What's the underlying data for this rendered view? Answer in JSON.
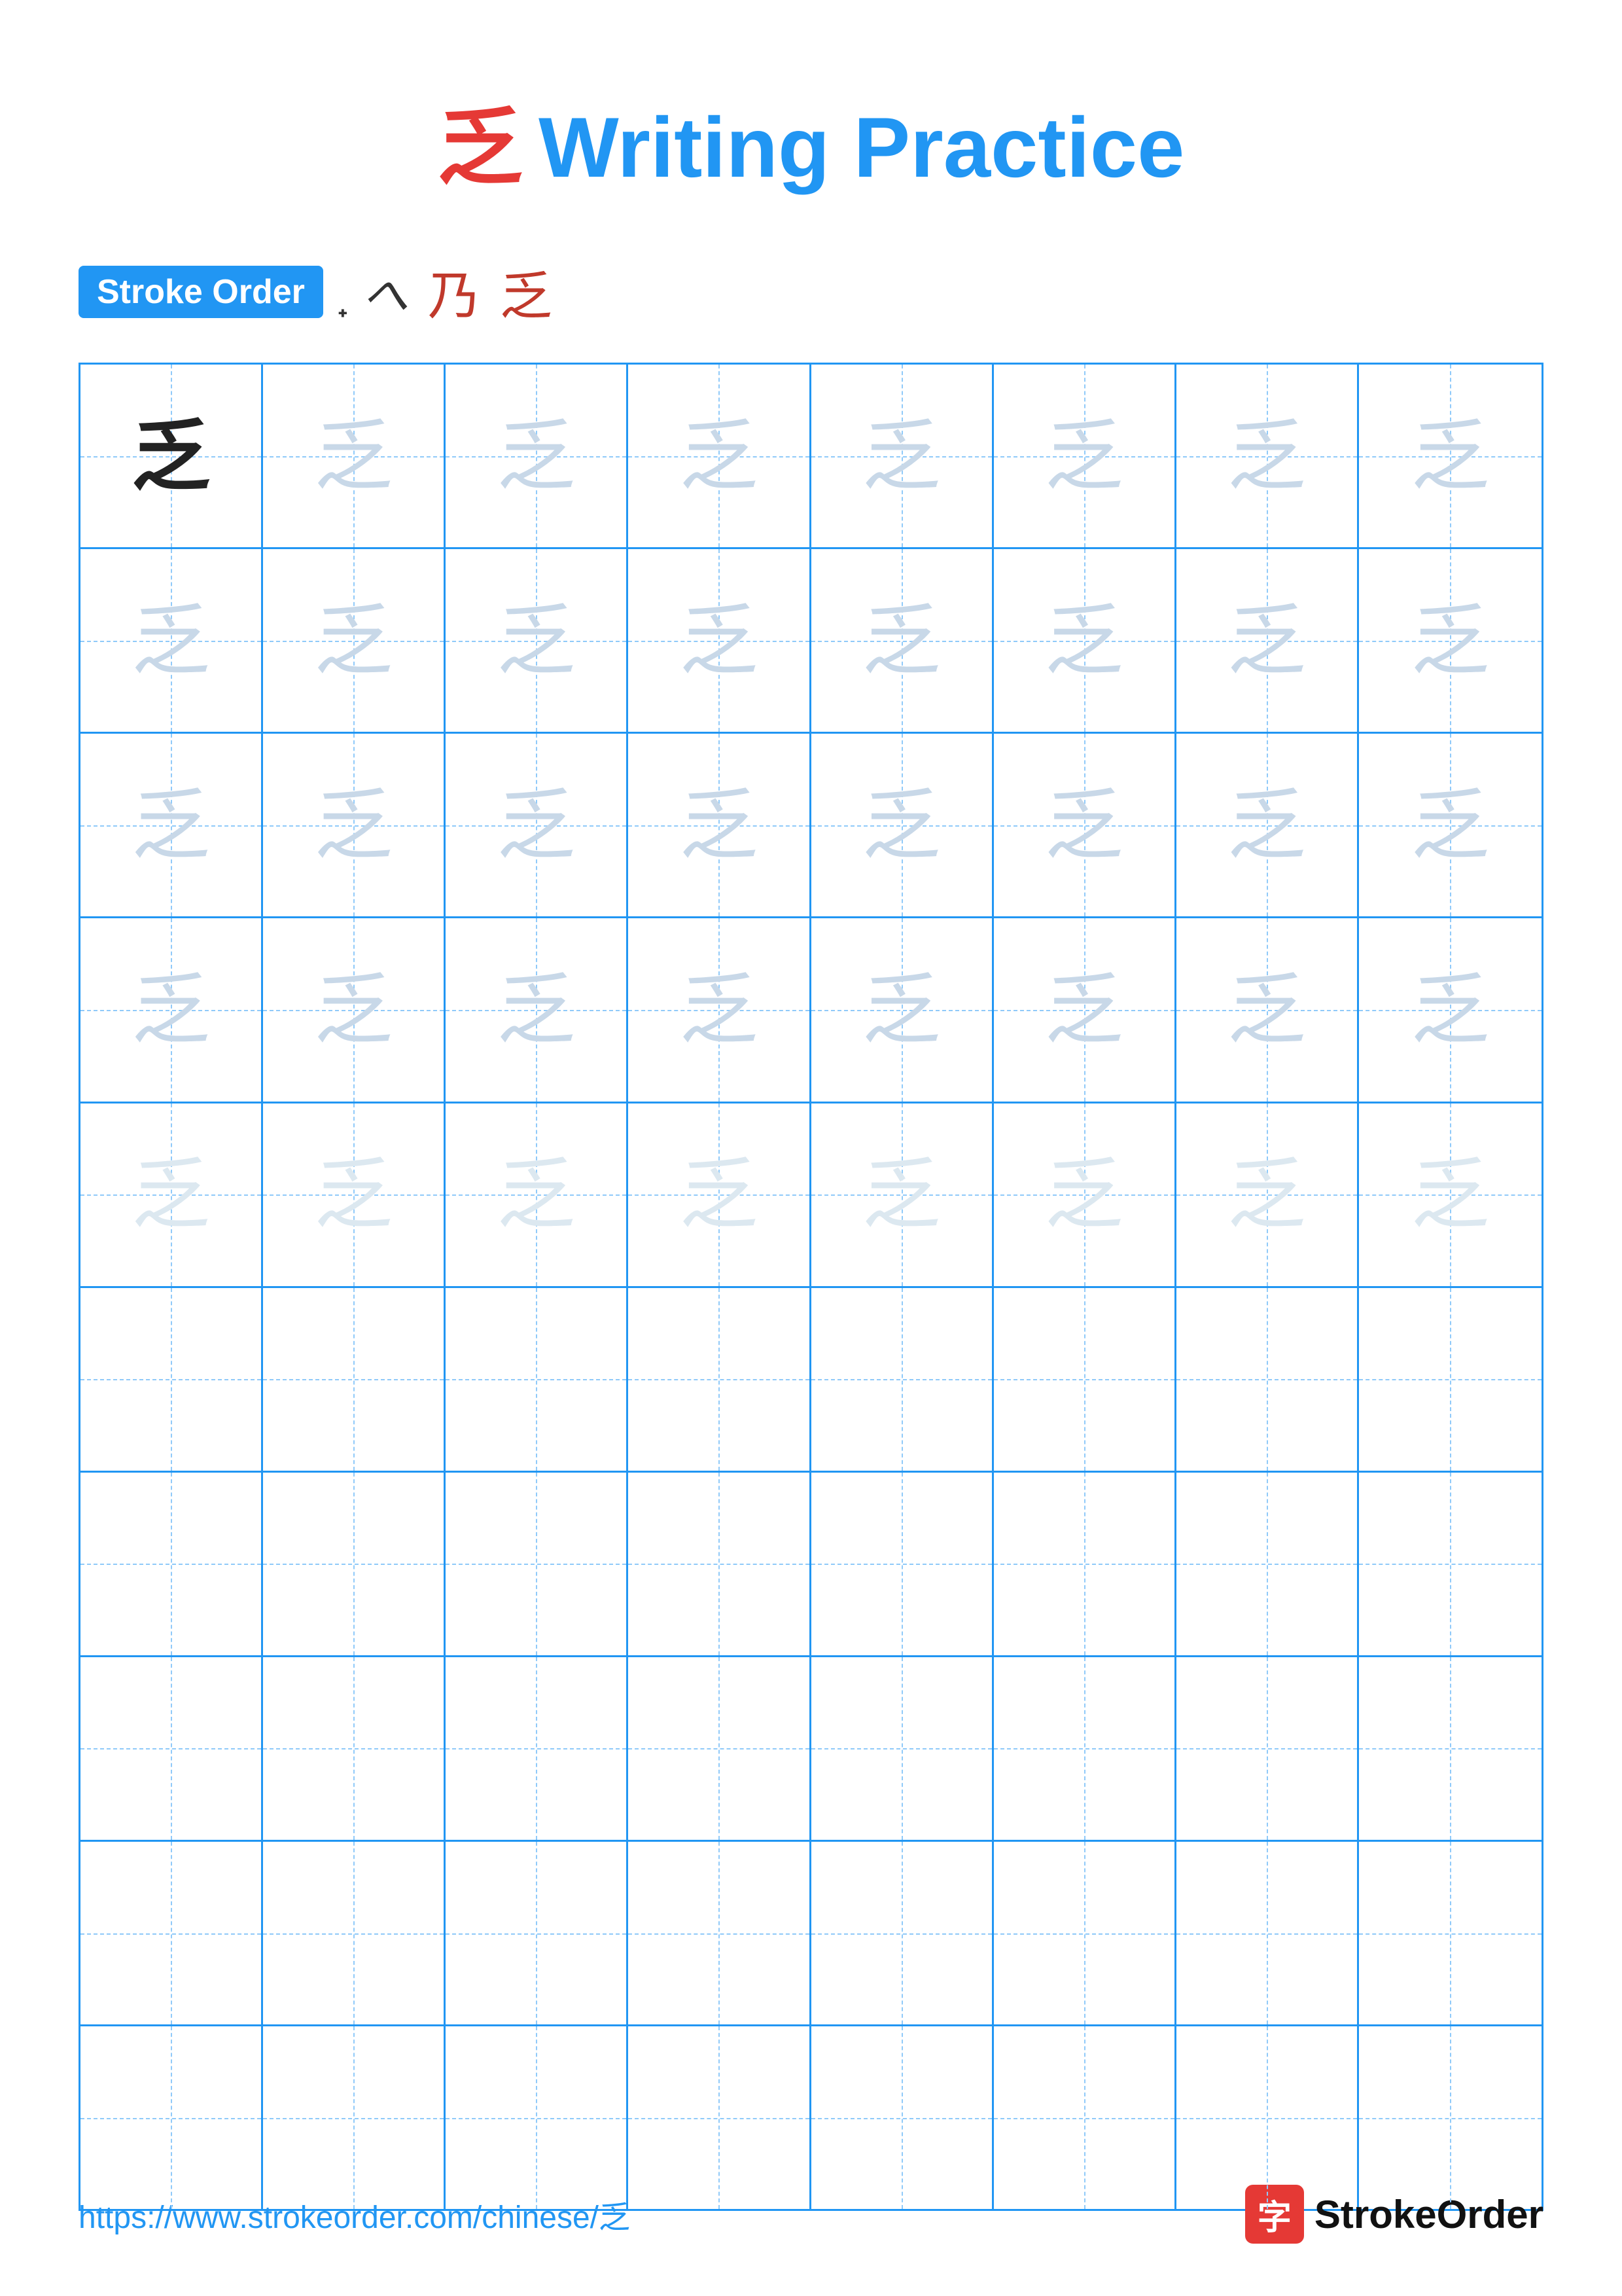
{
  "title": {
    "chinese": "乏",
    "english": "Writing Practice"
  },
  "strokeOrder": {
    "badge_label": "Stroke Order",
    "chars": [
      "丿",
      "㇀",
      "乃",
      "乏"
    ]
  },
  "grid": {
    "rows": 10,
    "cols": 8,
    "char": "乏",
    "filled_rows": 5
  },
  "footer": {
    "url": "https://www.strokeorder.com/chinese/乏",
    "brand_icon": "字",
    "brand_name": "StrokeOrder"
  }
}
